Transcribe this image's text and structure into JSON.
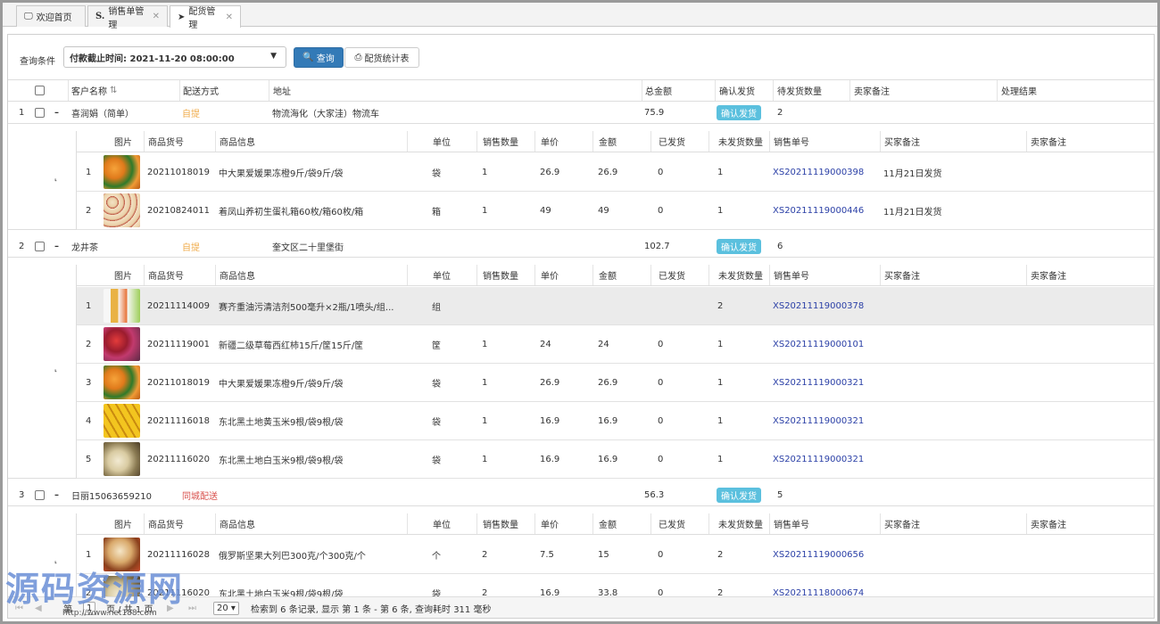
{
  "tabs": [
    {
      "label": "欢迎首页",
      "icon": "monitor-icon"
    },
    {
      "label": "销售单管理",
      "icon": "s-icon"
    },
    {
      "label": "配货管理",
      "icon": "send-icon"
    }
  ],
  "toolbar": {
    "query_label": "查询条件",
    "select_value": "付款截止时间:   2021-11-20 08:00:00",
    "query_button": "查询",
    "stat_button": "配货统计表"
  },
  "header": {
    "customer": "客户名称",
    "delivery": "配送方式",
    "address": "地址",
    "total": "总金额",
    "confirm": "确认发货",
    "pending": "待发货数量",
    "seller_note": "卖家备注",
    "result": "处理结果"
  },
  "sub_header": {
    "img": "图片",
    "code": "商品货号",
    "info": "商品信息",
    "unit": "单位",
    "qty": "销售数量",
    "price": "单价",
    "amount": "金额",
    "shipped": "已发货",
    "unshipped": "未发货数量",
    "order": "销售单号",
    "buyer_note": "买家备注",
    "seller_note": "卖家备注"
  },
  "groups": [
    {
      "index": "1",
      "customer": "喜润娟（简单）",
      "delivery": "自提",
      "address": "物流海化（大家洼）物流车",
      "total": "75.9",
      "confirm": "确认发货",
      "pending": "2",
      "items": [
        {
          "n": "1",
          "code": "20211018019",
          "info": "中大果爱媛果冻橙9斤/袋9斤/袋",
          "unit": "袋",
          "qty": "1",
          "price": "26.9",
          "amount": "26.9",
          "shipped": "0",
          "unshipped": "1",
          "order": "XS20211119000398",
          "buyer_note": "11月21日发货",
          "img": "orange"
        },
        {
          "n": "2",
          "code": "20210824011",
          "info": "着凤山养初生蛋礼箱60枚/箱60枚/箱",
          "unit": "箱",
          "qty": "1",
          "price": "49",
          "amount": "49",
          "shipped": "0",
          "unshipped": "1",
          "order": "XS20211119000446",
          "buyer_note": "11月21日发货",
          "img": "eggs"
        }
      ]
    },
    {
      "index": "2",
      "customer": "龙井茶",
      "delivery": "自提",
      "address": "奎文区二十里堡街",
      "total": "102.7",
      "confirm": "确认发货",
      "pending": "6",
      "items": [
        {
          "n": "1",
          "code": "20211114009",
          "info": "赛齐重油污清洁剂500毫升×2瓶/1喷头/组...",
          "unit": "组",
          "qty": "",
          "price": "",
          "amount": "",
          "shipped": "",
          "unshipped": "2",
          "order": "XS20211119000378",
          "buyer_note": "",
          "img": "bottles"
        },
        {
          "n": "2",
          "code": "20211119001",
          "info": "新疆二级草莓西红柿15斤/筐15斤/筐",
          "unit": "筐",
          "qty": "1",
          "price": "24",
          "amount": "24",
          "shipped": "0",
          "unshipped": "1",
          "order": "XS20211119000101",
          "buyer_note": "",
          "img": "tomato"
        },
        {
          "n": "3",
          "code": "20211018019",
          "info": "中大果爱媛果冻橙9斤/袋9斤/袋",
          "unit": "袋",
          "qty": "1",
          "price": "26.9",
          "amount": "26.9",
          "shipped": "0",
          "unshipped": "1",
          "order": "XS20211119000321",
          "buyer_note": "",
          "img": "orange"
        },
        {
          "n": "4",
          "code": "20211116018",
          "info": "东北黑土地黄玉米9根/袋9根/袋",
          "unit": "袋",
          "qty": "1",
          "price": "16.9",
          "amount": "16.9",
          "shipped": "0",
          "unshipped": "1",
          "order": "XS20211119000321",
          "buyer_note": "",
          "img": "corn"
        },
        {
          "n": "5",
          "code": "20211116020",
          "info": "东北黑土地白玉米9根/袋9根/袋",
          "unit": "袋",
          "qty": "1",
          "price": "16.9",
          "amount": "16.9",
          "shipped": "0",
          "unshipped": "1",
          "order": "XS20211119000321",
          "buyer_note": "",
          "img": "whitecorn"
        }
      ]
    },
    {
      "index": "3",
      "customer": "日丽15063659210",
      "delivery": "同城配送",
      "address": "",
      "total": "56.3",
      "confirm": "确认发货",
      "pending": "5",
      "items": [
        {
          "n": "1",
          "code": "20211116028",
          "info": "俄罗斯坚果大列巴300克/个300克/个",
          "unit": "个",
          "qty": "2",
          "price": "7.5",
          "amount": "15",
          "shipped": "0",
          "unshipped": "2",
          "order": "XS20211119000656",
          "buyer_note": "",
          "img": "bread"
        },
        {
          "n": "2",
          "code": "20211116020",
          "info": "东北黑土地白玉米9根/袋9根/袋",
          "unit": "袋",
          "qty": "2",
          "price": "16.9",
          "amount": "33.8",
          "shipped": "0",
          "unshipped": "2",
          "order": "XS20211118000674",
          "buyer_note": "",
          "img": "whitecorn"
        }
      ]
    }
  ],
  "pager": {
    "page_label": "第",
    "page": "1",
    "of_label": "页 / 共 1 页",
    "page_size": "20",
    "summary": "检索到 6 条记录, 显示 第 1 条 - 第 6 条, 查询耗时 311 毫秒"
  },
  "watermark": {
    "text": "源码资源网",
    "url": "http://www.net188.com"
  },
  "colors": {
    "primary": "#337ab7",
    "badge": "#5bc0de",
    "orange": "#f0ad4e",
    "red": "#d9534f",
    "link": "#2a3fa6"
  }
}
